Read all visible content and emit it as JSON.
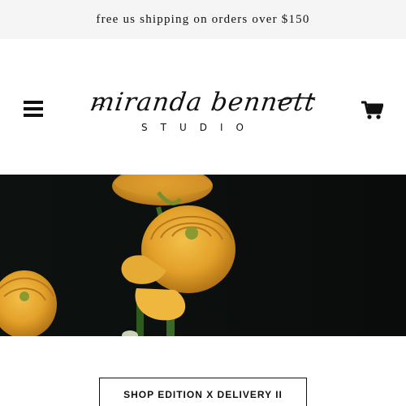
{
  "announcement": {
    "text": "free us shipping on orders over $150"
  },
  "header": {
    "logo_script": "miranda bennett",
    "logo_sub": "STUDIO"
  },
  "icons": {
    "menu": "hamburger-menu-icon",
    "cart": "shopping-cart-icon"
  },
  "hero": {
    "alt": "yellow ranunculus flowers on dark background"
  },
  "cta": {
    "label": "SHOP EDITION X DELIVERY II"
  },
  "colors": {
    "announcement_bg": "#f5f5f5",
    "hero_bg": "#0b0e0c",
    "flower": "#e8a72e",
    "text": "#111111"
  }
}
